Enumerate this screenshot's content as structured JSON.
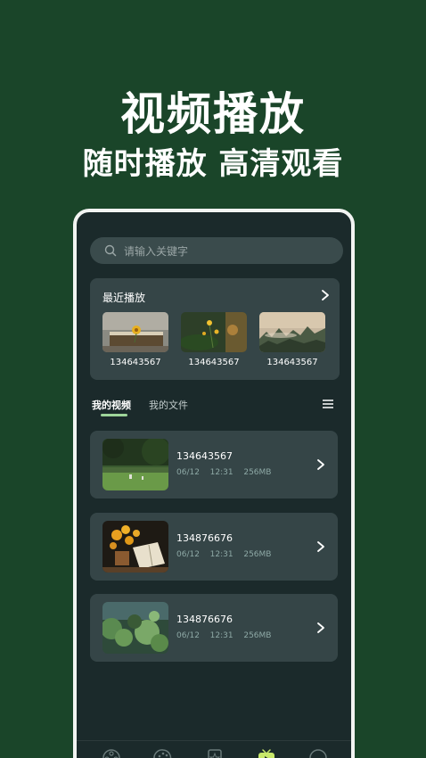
{
  "promo": {
    "title": "视频播放",
    "subtitle": "随时播放 高清观看"
  },
  "search": {
    "placeholder": "请输入关键字",
    "icon": "search-icon"
  },
  "recent": {
    "title": "最近播放",
    "items": [
      {
        "label": "134643567"
      },
      {
        "label": "134643567"
      },
      {
        "label": "134643567"
      }
    ]
  },
  "tabs": {
    "items": [
      {
        "label": "我的视频",
        "active": true
      },
      {
        "label": "我的文件",
        "active": false
      }
    ],
    "menu_icon": "list-menu-icon"
  },
  "videos": [
    {
      "name": "134643567",
      "date": "06/12",
      "time": "12:31",
      "size": "256MB"
    },
    {
      "name": "134876676",
      "date": "06/12",
      "time": "12:31",
      "size": "256MB"
    },
    {
      "name": "134876676",
      "date": "06/12",
      "time": "12:31",
      "size": "256MB"
    }
  ],
  "bottom_nav": [
    {
      "icon": "film-reel-icon",
      "active": false
    },
    {
      "icon": "palette-icon",
      "active": false
    },
    {
      "icon": "star-card-icon",
      "active": false
    },
    {
      "icon": "tv-play-icon",
      "active": true
    },
    {
      "icon": "smiley-icon",
      "active": false
    }
  ],
  "colors": {
    "background": "#1a4529",
    "screen": "#1b2a2b",
    "card": "#354547",
    "accent": "#9ed59a"
  }
}
